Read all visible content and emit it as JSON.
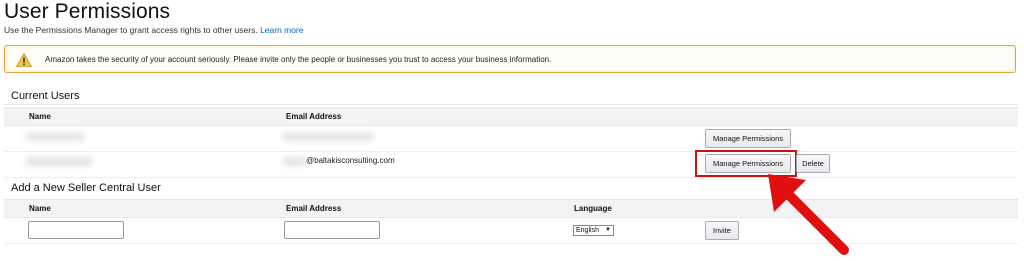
{
  "header": {
    "title": "User Permissions",
    "subtitle": "Use the Permissions Manager to grant access rights to other users.",
    "learn_more": "Learn more"
  },
  "alert": {
    "icon": "warning-icon",
    "text": "Amazon takes the security of your account seriously. Please invite only the people or businesses you trust to access your business information.",
    "border_color": "#e3a342"
  },
  "current_users": {
    "title": "Current Users",
    "columns": {
      "name": "Name",
      "email": "Email Address"
    },
    "rows": [
      {
        "email_visible": "",
        "manage_label": "Manage Permissions"
      },
      {
        "email_visible": "@baltakisconsulting.com",
        "manage_label": "Manage Permissions",
        "delete_label": "Delete"
      }
    ]
  },
  "add_user": {
    "title": "Add a New Seller Central User",
    "columns": {
      "name": "Name",
      "email": "Email Address",
      "language": "Language"
    },
    "name_value": "",
    "email_value": "",
    "language_selected": "English",
    "invite_label": "Invite"
  },
  "annotation": {
    "highlight_color": "#d10f0f",
    "arrow_color": "#e01010"
  }
}
